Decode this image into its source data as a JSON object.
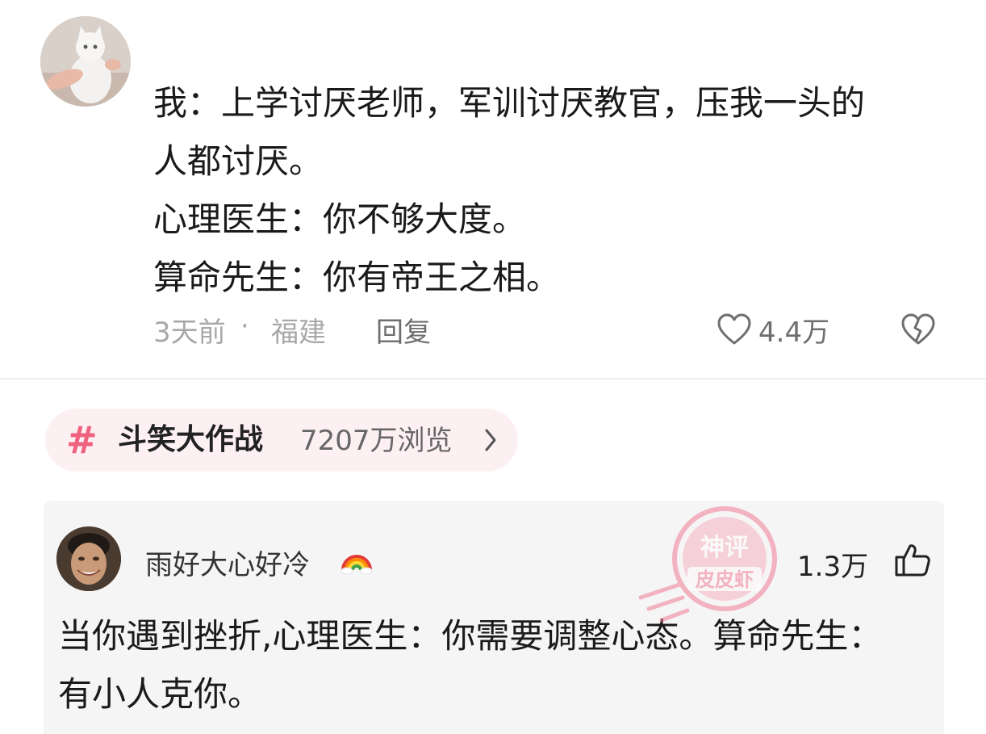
{
  "comment": {
    "lines": [
      "我：上学讨厌老师，军训讨厌教官，压我一头的",
      "人都讨厌。",
      "心理医生：你不够大度。",
      "算命先生：你有帝王之相。"
    ],
    "time": "3天前",
    "separator": "·",
    "location": "福建",
    "reply_label": "回复",
    "like_count": "4.4万",
    "avatar_icon": "cat-avatar",
    "like_icon": "heart-outline-icon",
    "dislike_icon": "broken-heart-icon"
  },
  "topic": {
    "hash": "#",
    "name": "斗笑大作战",
    "views": "7207万浏览",
    "chevron": "›",
    "accent_color": "#f0627e",
    "background_color": "#fdf0f2"
  },
  "hot_reply": {
    "username": "雨好大心好冷",
    "badge_icon": "rainbow-emoji",
    "like_count": "1.3万",
    "like_icon": "thumbs-up-icon",
    "lines": [
      "当你遇到挫折,心理医生：你需要调整心态。算命先生：",
      "有小人克你。"
    ]
  },
  "watermark": {
    "top_text": "神评",
    "bottom_text": "皮皮虾",
    "color": "#f07c96"
  }
}
